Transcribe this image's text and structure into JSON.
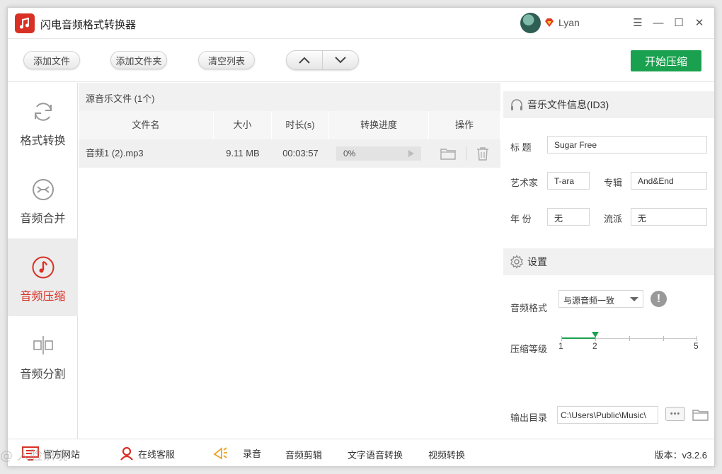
{
  "app": {
    "title": "闪电音频格式转换器"
  },
  "user": {
    "name": "Lyan"
  },
  "window_controls": {
    "menu": "☰",
    "minimize": "—",
    "maximize": "☐",
    "close": "✕"
  },
  "toolbar": {
    "add_file": "添加文件",
    "add_folder": "添加文件夹",
    "clear_list": "清空列表",
    "start": "开始压缩"
  },
  "sidebar": {
    "items": [
      {
        "label": "格式转换",
        "icon": "refresh-icon"
      },
      {
        "label": "音频合并",
        "icon": "merge-icon"
      },
      {
        "label": "音频压缩",
        "icon": "music-note-icon"
      },
      {
        "label": "音频分割",
        "icon": "split-icon"
      }
    ],
    "active_index": 2
  },
  "file_list": {
    "header": "源音乐文件 (1个)",
    "columns": [
      "文件名",
      "大小",
      "时长(s)",
      "转换进度",
      "操作"
    ],
    "rows": [
      {
        "name": "音频1 (2).mp3",
        "size": "9.11 MB",
        "duration": "00:03:57",
        "progress": "0%"
      }
    ]
  },
  "id3": {
    "header": "音乐文件信息(ID3)",
    "title_label": "标  题",
    "title_value": "Sugar Free",
    "artist_label": "艺术家",
    "artist_value": "T-ara",
    "album_label": "专辑",
    "album_value": "And&End",
    "year_label": "年  份",
    "year_value": "无",
    "genre_label": "流派",
    "genre_value": "无"
  },
  "settings": {
    "header": "设置",
    "format_label": "音频格式",
    "format_value": "与源音频一致",
    "level_label": "压缩等级",
    "level_min": "1",
    "level_value": "2",
    "level_max": "5",
    "output_label": "输出目录",
    "output_value": "C:\\Users\\Public\\Music\\",
    "dots": "•••"
  },
  "statusbar": {
    "website": "官方网站",
    "support": "在线客服",
    "record": "录音",
    "cut": "音频剪辑",
    "tts": "文字语音转换",
    "video": "视频转换",
    "version": "版本：v3.2.6"
  },
  "watermark": "@ 人脸识境"
}
